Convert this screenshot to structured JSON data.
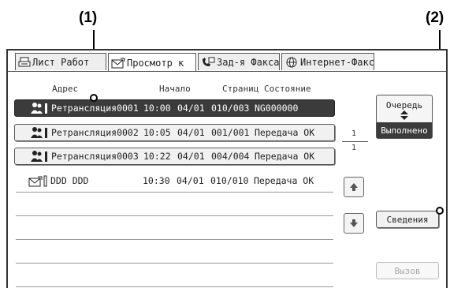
{
  "callouts": {
    "one": "(1)",
    "two": "(2)"
  },
  "tabs": [
    {
      "label": "Лист Работ"
    },
    {
      "label": "Просмотр к"
    },
    {
      "label": "Зад-я Факса"
    },
    {
      "label": "Интернет-Факс"
    }
  ],
  "columns": {
    "address": "Адрес",
    "start": "Начало",
    "pages": "Страниц",
    "status": "Состояние"
  },
  "rows": [
    {
      "name": "Ретрансляция0001",
      "start": "10:00",
      "date": "04/01",
      "pages": "010/003",
      "status": "NG000000"
    },
    {
      "name": "Ретрансляция0002",
      "start": "10:05",
      "date": "04/01",
      "pages": "001/001",
      "status": "Передача OK"
    },
    {
      "name": "Ретрансляция0003",
      "start": "10:22",
      "date": "04/01",
      "pages": "004/004",
      "status": "Передача OK"
    },
    {
      "name": "DDD DDD",
      "start": "10:30",
      "date": "04/01",
      "pages": "010/010",
      "status": "Передача OK"
    }
  ],
  "pagination": {
    "current": "1",
    "total": "1"
  },
  "queue": {
    "label": "Очередь",
    "selected": "Выполнено"
  },
  "buttons": {
    "details": "Сведения",
    "call": "Вызов"
  }
}
